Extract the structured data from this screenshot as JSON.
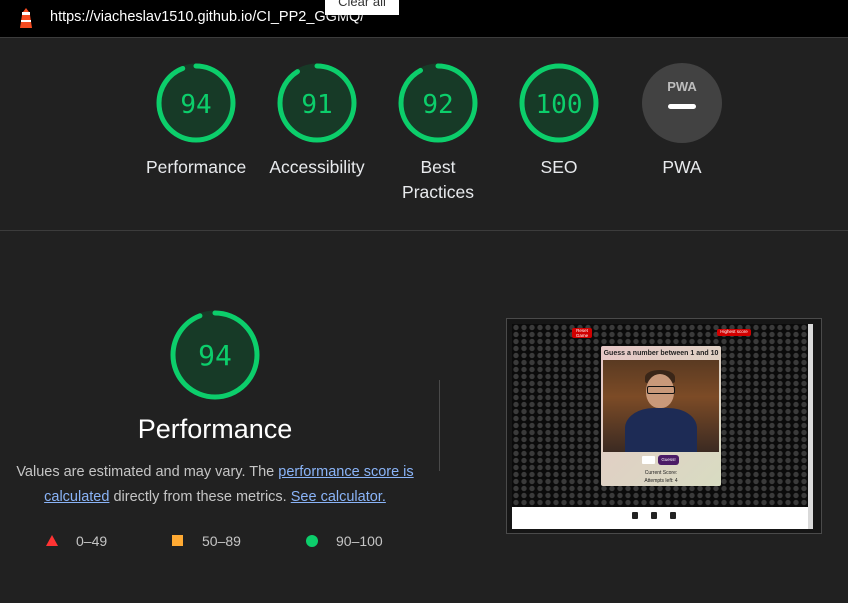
{
  "topbar": {
    "url": "https://viacheslav1510.github.io/CI_PP2_GGMQ/",
    "tooltip": "Clear all"
  },
  "categories": [
    {
      "label": "Performance",
      "score": "94",
      "value": 94
    },
    {
      "label": "Accessibility",
      "score": "91",
      "value": 91
    },
    {
      "label": "Best Practices",
      "score": "92",
      "value": 92
    },
    {
      "label": "SEO",
      "score": "100",
      "value": 100
    },
    {
      "label": "PWA",
      "score": "PWA",
      "value": null
    }
  ],
  "performance": {
    "score": "94",
    "value": 94,
    "title": "Performance",
    "desc_prefix": "Values are estimated and may vary. The ",
    "link_score": "performance score is calculated",
    "desc_middle": " directly from these metrics. ",
    "link_calc": "See calculator."
  },
  "legend": [
    {
      "range": "0–49",
      "color": "#ff3333"
    },
    {
      "range": "50–89",
      "color": "#ffaa33"
    },
    {
      "range": "90–100",
      "color": "#0cce6b"
    }
  ],
  "thumbnail": {
    "reset_btn": "Reset Game",
    "highest_btn": "Highest score",
    "card_title": "Guess a number between 1 and 10",
    "guess_btn": "Guess!",
    "current_score": "Current Score:",
    "attempts": "Attempts left: 4"
  },
  "colors": {
    "pass": "#0cce6b",
    "gauge_bg": "#173a27",
    "pwa_bg": "#424242"
  }
}
